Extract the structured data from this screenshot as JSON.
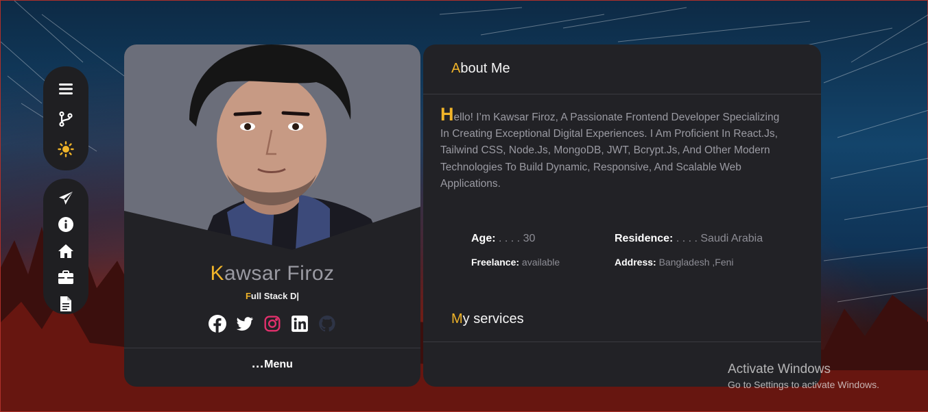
{
  "nav": {
    "top": [
      {
        "icon": "menu-icon"
      },
      {
        "icon": "git-branch-icon"
      },
      {
        "icon": "sun-icon",
        "color": "#f0b429"
      }
    ],
    "bottom": [
      {
        "icon": "send-icon"
      },
      {
        "icon": "info-icon"
      },
      {
        "icon": "home-icon"
      },
      {
        "icon": "briefcase-icon"
      },
      {
        "icon": "document-icon"
      }
    ]
  },
  "profile": {
    "name_first": "K",
    "name_rest": "awsar Firoz",
    "role_first": "F",
    "role_rest": "ull Stack D|",
    "socials": [
      "facebook-icon",
      "twitter-icon",
      "instagram-icon",
      "linkedin-icon",
      "github-icon"
    ],
    "menu_dots": "...",
    "menu_label": "Menu"
  },
  "about": {
    "title_first": "A",
    "title_rest": "bout Me",
    "bio_first": "H",
    "bio_rest": "ello! I’m Kawsar Firoz, A Passionate Frontend Developer Specializing In Creating Exceptional Digital Experiences. I Am Proficient In React.Js, Tailwind CSS, Node.Js, MongoDB, JWT, Bcrypt.Js, And Other Modern Technologies To Build Dynamic, Responsive, And Scalable Web Applications.",
    "age_label": "Age:",
    "age_value": " . . . . 30",
    "residence_label": "Residence:",
    "residence_value": " . . . . Saudi Arabia",
    "freelance_label": "Freelance:",
    "freelance_value": " available",
    "address_label": "Address:",
    "address_value": " Bangladesh ,Feni"
  },
  "services": {
    "title_first": "M",
    "title_rest": "y services"
  },
  "watermark": {
    "line1": "Activate Windows",
    "line2": "Go to Settings to activate Windows."
  },
  "colors": {
    "accent": "#f0b429",
    "card_bg": "#222226",
    "instagram": "#e1306c"
  }
}
